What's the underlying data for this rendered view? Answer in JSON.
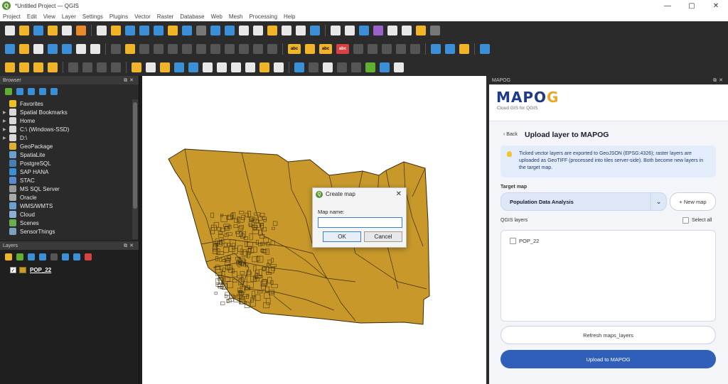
{
  "window": {
    "title": "*Untitled Project — QGIS",
    "minimize": "—",
    "maximize": "▢",
    "close": "✕"
  },
  "menu": [
    "Project",
    "Edit",
    "View",
    "Layer",
    "Settings",
    "Plugins",
    "Vector",
    "Raster",
    "Database",
    "Web",
    "Mesh",
    "Processing",
    "Help"
  ],
  "browser": {
    "title": "Browser",
    "items": [
      {
        "label": "Favorites",
        "icon": "star-icon",
        "color": "#f0c020",
        "arrow": ""
      },
      {
        "label": "Spatial Bookmarks",
        "icon": "bookmark-folder-icon",
        "color": "#d9d9d9",
        "arrow": "▶"
      },
      {
        "label": "Home",
        "icon": "folder-icon",
        "color": "#d9d9d9",
        "arrow": "▶"
      },
      {
        "label": "C:\\ (Windows-SSD)",
        "icon": "drive-icon",
        "color": "#d9d9d9",
        "arrow": "▶"
      },
      {
        "label": "D:\\",
        "icon": "drive-icon",
        "color": "#d9d9d9",
        "arrow": "▶"
      },
      {
        "label": "GeoPackage",
        "icon": "geopackage-icon",
        "color": "#e0b030",
        "arrow": ""
      },
      {
        "label": "SpatiaLite",
        "icon": "spatialite-icon",
        "color": "#6aa0d0",
        "arrow": ""
      },
      {
        "label": "PostgreSQL",
        "icon": "postgresql-icon",
        "color": "#4a7fb5",
        "arrow": ""
      },
      {
        "label": "SAP HANA",
        "icon": "sap-hana-icon",
        "color": "#3a8fd6",
        "arrow": ""
      },
      {
        "label": "STAC",
        "icon": "stac-icon",
        "color": "#5a8ad0",
        "arrow": ""
      },
      {
        "label": "MS SQL Server",
        "icon": "mssql-icon",
        "color": "#9a9a9a",
        "arrow": ""
      },
      {
        "label": "Oracle",
        "icon": "oracle-icon",
        "color": "#aaaaaa",
        "arrow": ""
      },
      {
        "label": "WMS/WMTS",
        "icon": "globe-icon",
        "color": "#6aa0d0",
        "arrow": ""
      },
      {
        "label": "Cloud",
        "icon": "cloud-icon",
        "color": "#8ab0d8",
        "arrow": ""
      },
      {
        "label": "Scenes",
        "icon": "scenes-icon",
        "color": "#6ab04a",
        "arrow": ""
      },
      {
        "label": "SensorThings",
        "icon": "sensor-icon",
        "color": "#7aa0c0",
        "arrow": ""
      }
    ]
  },
  "layers": {
    "title": "Layers",
    "items": [
      {
        "name": "POP_22",
        "checked": "✓",
        "color": "#cc9a2a"
      }
    ]
  },
  "dialog": {
    "title": "Create map",
    "label": "Map name:",
    "value": "",
    "ok": "OK",
    "cancel": "Cancel",
    "close": "✕"
  },
  "mapog": {
    "panel_title": "MAPOG",
    "logo_main": "MAPO",
    "logo_accent": "G",
    "logo_sub": "Cloud GIS for QGIS",
    "back": "‹ Back",
    "heading": "Upload layer to MAPOG",
    "info": "Ticked vector layers are exported to GeoJSON (EPSG:4326); raster layers are uploaded as GeoTIFF (processed into tiles server-side). Both become new layers in the target map.",
    "target_label": "Target map",
    "target_value": "Population Data Analysis",
    "chevron": "⌄",
    "new_map": "+ New map",
    "qgis_layers_label": "QGIS layers",
    "select_all": "Select all",
    "layers": [
      {
        "name": "POP_22"
      }
    ],
    "refresh": "Refresh maps_layers",
    "upload": "Upload to MAPOG"
  },
  "colors": {
    "map_fill": "#c8992a",
    "map_stroke": "#3a2a08",
    "accent_blue": "#2f5fb8",
    "logo_blue": "#1e3a8a",
    "logo_gold": "#e8a72a"
  }
}
